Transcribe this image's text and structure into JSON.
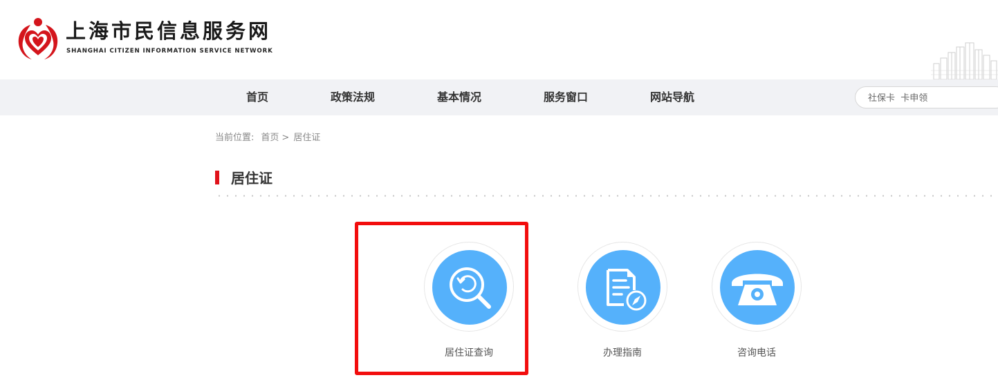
{
  "header": {
    "site_title": "上海市民信息服务网",
    "site_subtitle": "SHANGHAI CITIZEN INFORMATION SERVICE NETWORK"
  },
  "nav": {
    "items": [
      "首页",
      "政策法规",
      "基本情况",
      "服务窗口",
      "网站导航"
    ]
  },
  "search": {
    "placeholder": "社保卡  卡申领"
  },
  "breadcrumb": {
    "prefix": "当前位置:",
    "home": "首页",
    "separator": ">",
    "current": "居住证"
  },
  "section": {
    "title": "居住证"
  },
  "services": [
    {
      "label": "居住证查询",
      "icon": "search-refresh-icon"
    },
    {
      "label": "办理指南",
      "icon": "document-compass-icon"
    },
    {
      "label": "咨询电话",
      "icon": "telephone-icon"
    }
  ],
  "colors": {
    "brand_red": "#e0121a",
    "icon_blue": "#55b1fb",
    "nav_bg": "#f1f2f5",
    "highlight": "#f20d0d"
  }
}
